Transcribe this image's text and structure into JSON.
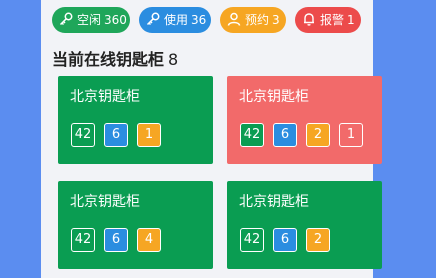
{
  "stats": [
    {
      "icon": "key-icon",
      "label": "空闲",
      "value": "360",
      "color": "#1fa65a"
    },
    {
      "icon": "key-icon",
      "label": "使用",
      "value": "36",
      "color": "#2b8de0"
    },
    {
      "icon": "user-icon",
      "label": "预约",
      "value": "3",
      "color": "#f6a623"
    },
    {
      "icon": "bell-icon",
      "label": "报警",
      "value": "1",
      "color": "#ec4b4b"
    }
  ],
  "heading": {
    "label": "当前在线钥匙柜",
    "count": "8"
  },
  "cards": [
    {
      "title": "北京钥匙柜",
      "color": "#0a9d52",
      "badges": [
        "42",
        "6",
        "1"
      ]
    },
    {
      "title": "北京钥匙柜",
      "color": "#f26a6a",
      "badges": [
        "42",
        "6",
        "2",
        "1"
      ]
    },
    {
      "title": "北京钥匙柜",
      "color": "#0a9d52",
      "badges": [
        "42",
        "6",
        "4"
      ]
    },
    {
      "title": "北京钥匙柜",
      "color": "#0a9d52",
      "badges": [
        "42",
        "6",
        "2"
      ]
    }
  ]
}
